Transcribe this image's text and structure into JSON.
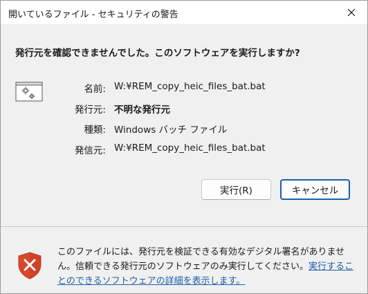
{
  "window": {
    "title": "開いているファイル - セキュリティの警告",
    "close_glyph": "✕"
  },
  "dialog": {
    "question": "発行元を確認できませんでした。このソフトウェアを実行しますか?",
    "details": [
      {
        "label": "名前:",
        "value": "W:¥REM_copy_heic_files_bat.bat",
        "bold": false
      },
      {
        "label": "発行元:",
        "value": "不明な発行元",
        "bold": true
      },
      {
        "label": "種類:",
        "value": "Windows バッチ ファイル",
        "bold": false
      },
      {
        "label": "発信元:",
        "value": "W:¥REM_copy_heic_files_bat.bat",
        "bold": false
      }
    ],
    "app_icon": "batch-file-gear-icon"
  },
  "buttons": {
    "run_label": "実行(R)",
    "cancel_label": "キャンセル"
  },
  "footer": {
    "warning_text": "このファイルには、発行元を検証できる有効なデジタル署名がありません。信頼できる発行元のソフトウェアのみ実行してください。",
    "link_text": "実行することのできるソフトウェアの詳細を表示します。",
    "shield_icon": "shield-x-icon",
    "shield_color": "#d9472b"
  },
  "colors": {
    "accent": "#1b5fa8",
    "background": "#f0f0f0"
  }
}
